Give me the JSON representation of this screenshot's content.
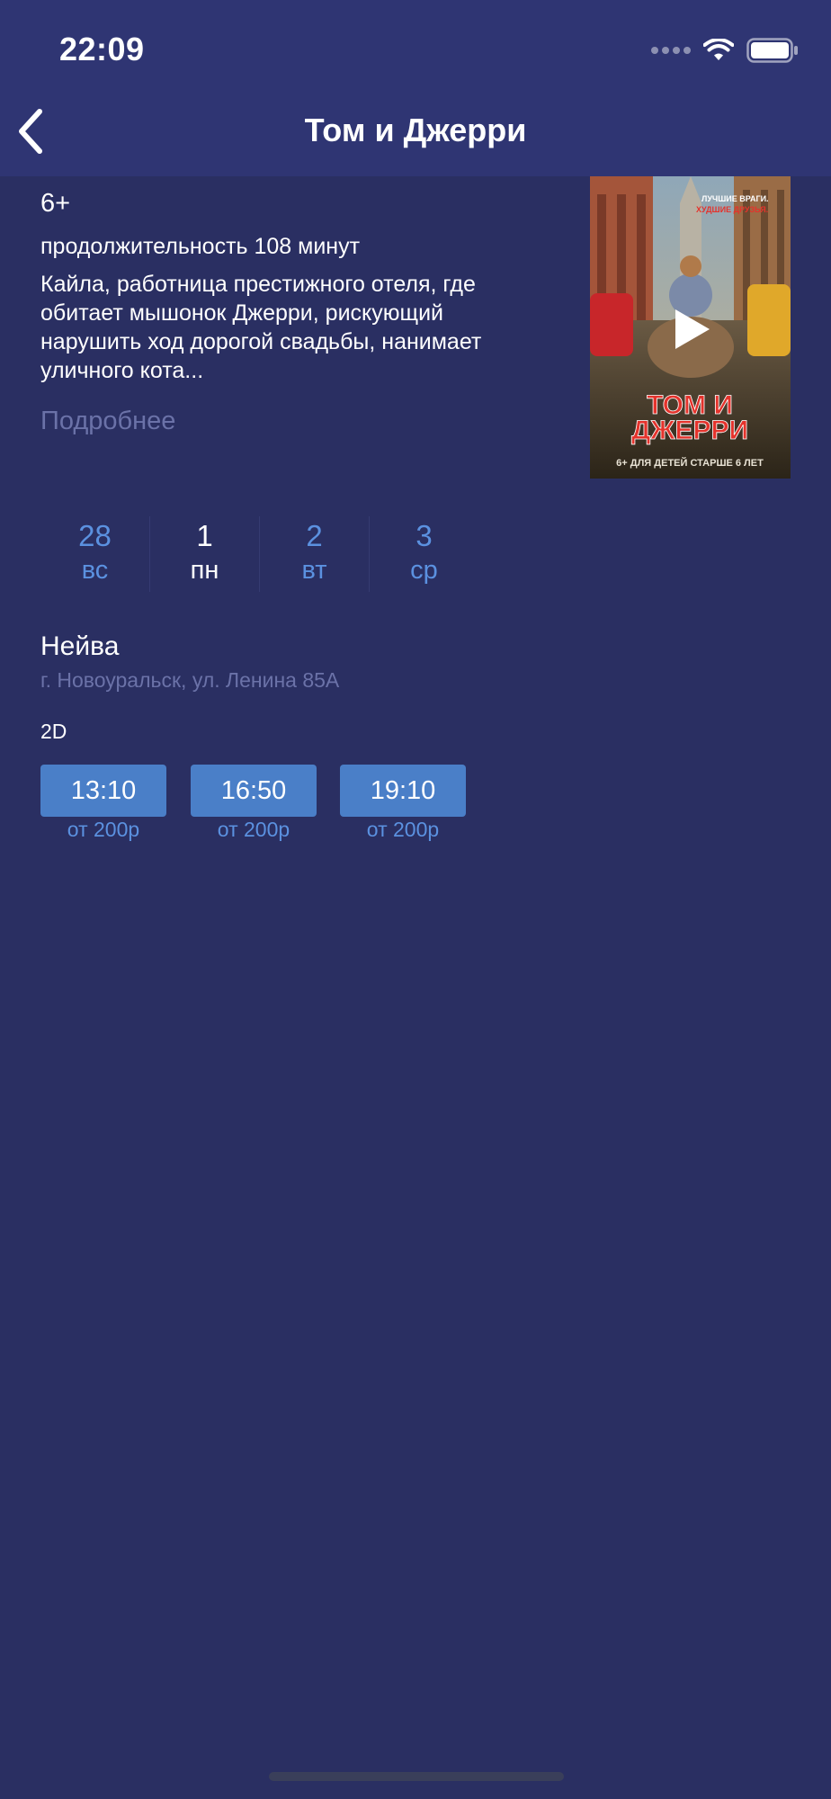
{
  "status_bar": {
    "time": "22:09",
    "icons": [
      "signal-dots-icon",
      "wifi-icon",
      "battery-icon"
    ]
  },
  "nav": {
    "title": "Том и Джерри",
    "back_icon": "chevron-left-icon"
  },
  "movie": {
    "rating": "6+",
    "duration": "продолжительность 108 минут",
    "description": "Кайла, работница престижного отеля, где обитает мышонок Джерри, рискующий нарушить ход дорогой свадьбы, нанимает уличного кота...",
    "more_label": "Подробнее",
    "poster": {
      "tagline_line1": "ЛУЧШИЕ ВРАГИ.",
      "tagline_line2": "ХУДШИЕ ДРУЗЬЯ.",
      "title_line1": "ТОМ И",
      "title_line2": "ДЖЕРРИ",
      "age_note": "6+ ДЛЯ ДЕТЕЙ СТАРШЕ 6 ЛЕТ",
      "play_icon": "play-icon"
    }
  },
  "days": [
    {
      "num": "28",
      "name": "вс",
      "active": false
    },
    {
      "num": "1",
      "name": "пн",
      "active": true
    },
    {
      "num": "2",
      "name": "вт",
      "active": false
    },
    {
      "num": "3",
      "name": "ср",
      "active": false
    }
  ],
  "cinema": {
    "name": "Нейва",
    "address": "г. Новоуральск, ул. Ленина 85А",
    "format": "2D",
    "sessions": [
      {
        "time": "13:10",
        "price": "от 200р"
      },
      {
        "time": "16:50",
        "price": "от 200р"
      },
      {
        "time": "19:10",
        "price": "от 200р"
      }
    ]
  },
  "colors": {
    "background": "#2a2f62",
    "header": "#2f3573",
    "accent_blue": "#5b91e0",
    "button_blue": "#4a7fc8",
    "muted_text": "#6b72a8"
  }
}
